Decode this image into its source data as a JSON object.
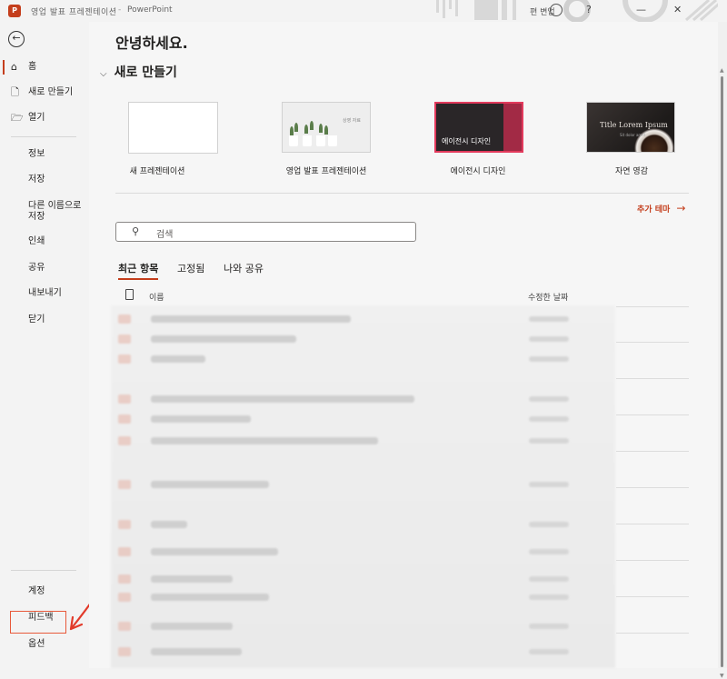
{
  "titlebar": {
    "app_logo": "P",
    "document_title": "영업 발표 프레젠테이션",
    "separator": "-",
    "app_name": "PowerPoint",
    "user_label": "편 변업",
    "help": "?",
    "minimize": "—",
    "close": "✕"
  },
  "nav": {
    "back_icon": "←",
    "home": {
      "icon": "⌂",
      "label": "홈"
    },
    "new": {
      "icon": "🗋",
      "label": "새로 만들기"
    },
    "open": {
      "icon": "🗁",
      "label": "열기"
    },
    "info": "정보",
    "save": "저장",
    "save_as_line1": "다른 이름으로",
    "save_as_line2": "저장",
    "print": "인쇄",
    "share": "공유",
    "export": "내보내기",
    "close": "닫기",
    "account": "계정",
    "feedback": "피드백",
    "options": "옵션"
  },
  "main": {
    "greeting": "안녕하세요.",
    "new_section": {
      "chevron": "⌵",
      "title": "새로 만들기"
    },
    "templates": [
      {
        "caption": "새 프레젠테이션"
      },
      {
        "caption": "영업 발표 프레젠테이션",
        "thumb_text": "상영 자료"
      },
      {
        "caption": "에이전시 디자인",
        "thumb_text": "에이전시 디자인"
      },
      {
        "caption": "자연 영감",
        "thumb_text": "Title Lorem Ipsum",
        "thumb_sub": "Sit dolor amet"
      }
    ],
    "more_themes": "추가 테마",
    "more_themes_arrow": "→",
    "search": {
      "icon": "⚲",
      "placeholder": "검색"
    },
    "tabs": [
      {
        "label": "최근 항목",
        "active": true
      },
      {
        "label": "고정됨",
        "active": false
      },
      {
        "label": "나와 공유",
        "active": false
      }
    ],
    "columns": {
      "name": "이름",
      "modified": "수정한 날짜"
    }
  },
  "colors": {
    "accent": "#c43e1c",
    "annotation": "#e8593a"
  }
}
